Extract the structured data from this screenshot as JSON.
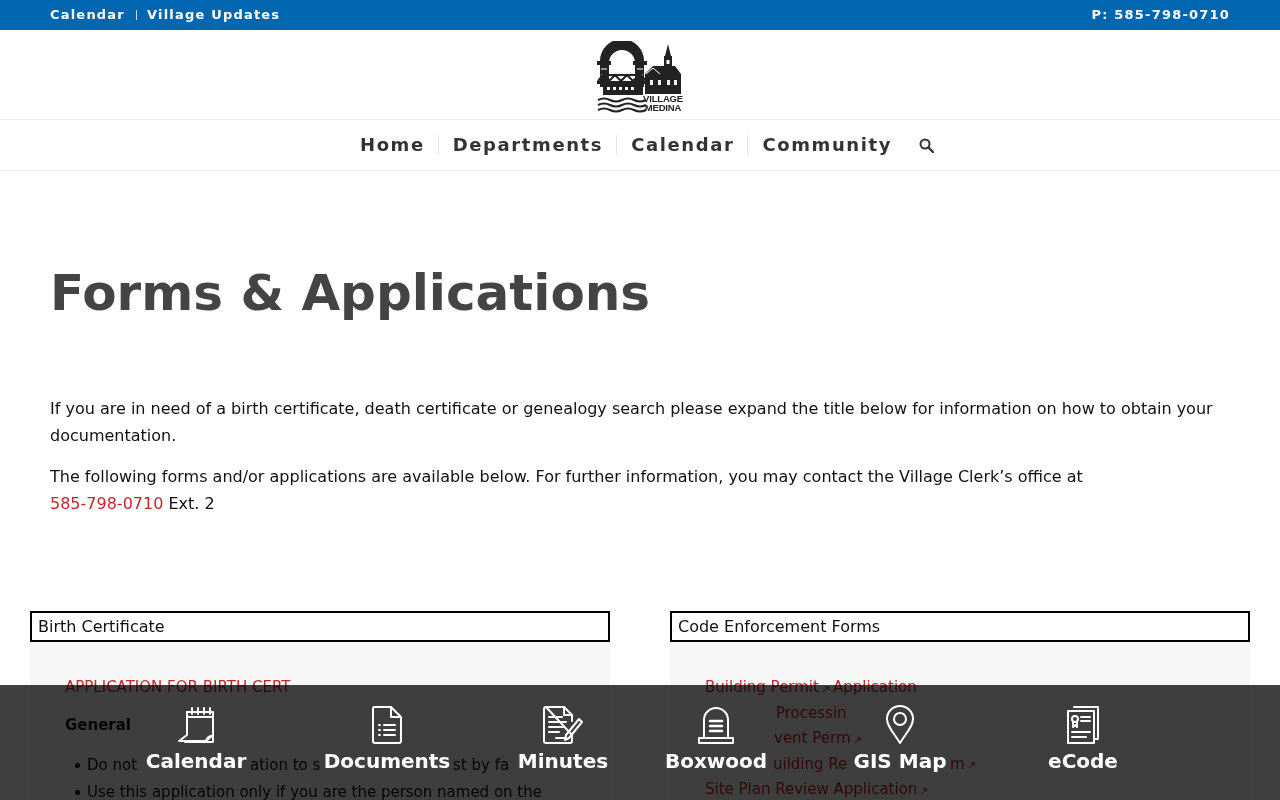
{
  "top_bar": {
    "links": [
      "Calendar",
      "Village Updates"
    ],
    "phone": "P: 585-798-0710"
  },
  "logo": {
    "lines": [
      "VILLAGE",
      "MEDINA"
    ]
  },
  "nav": {
    "items": [
      "Home",
      "Departments",
      "Calendar",
      "Community"
    ]
  },
  "page_title": "Forms & Applications",
  "intro": {
    "paragraph": "If you are in need of a birth certificate, death certificate or genealogy search please expand the title below for information on how to obtain your documentation.",
    "contact": {
      "text": "The following forms and/or applications are available below. For further information, you may contact the Village Clerk’s office at",
      "phone": "585-798-0710",
      "after": "Ext. 2"
    }
  },
  "panels": [
    {
      "title": "Birth Certificate",
      "content": [
        {
          "kind": "link",
          "segments": [
            {
              "text": "APPLICATION FOR BIRTH CERT",
              "external": false
            }
          ]
        },
        {
          "kind": "heading",
          "text": "General"
        },
        {
          "kind": "bullet",
          "pieces": [
            "Do not",
            "ation to s",
            "st by fa"
          ]
        },
        {
          "kind": "bullet",
          "pieces": [
            "Use this application only if you are the person named on the"
          ]
        }
      ]
    },
    {
      "title": "Code Enforcement Forms",
      "content": [
        {
          "kind": "link",
          "segments": [
            {
              "text": "Building Permit",
              "external": true
            },
            {
              "text": "Application",
              "external": false
            }
          ]
        },
        {
          "kind": "link",
          "segments": [
            {
              "text": "Processin",
              "external": false
            }
          ]
        },
        {
          "kind": "link",
          "segments": [
            {
              "text": "vent Perm",
              "external": true
            }
          ]
        },
        {
          "kind": "link",
          "segments": [
            {
              "text": "uilding Re",
              "external": false
            },
            {
              "text": "m",
              "external": true
            }
          ]
        },
        {
          "kind": "link",
          "segments": [
            {
              "text": "Site Plan Review Application",
              "external": true
            }
          ]
        }
      ]
    }
  ],
  "quick_links": [
    "Calendar",
    "Documents",
    "Minutes",
    "Boxwood",
    "GIS Map",
    "eCode"
  ]
}
